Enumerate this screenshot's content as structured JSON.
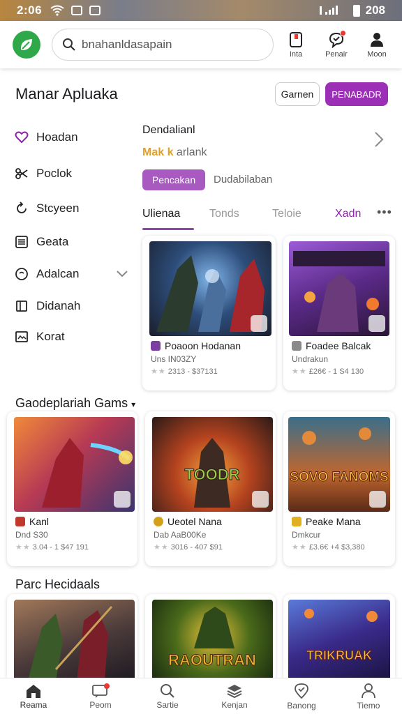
{
  "status_bar": {
    "time": "2:06",
    "right_text": "208"
  },
  "search": {
    "value": "bnahanl",
    "placeholder": "dasapain"
  },
  "top_actions": [
    {
      "label": "Inta"
    },
    {
      "label": "Penair"
    },
    {
      "label": "Moon"
    }
  ],
  "page": {
    "title": "Manar Apluaka",
    "outline_button": "Garnen",
    "primary_button": "PENABADR"
  },
  "sidebar": {
    "items": [
      {
        "label": "Hoadan"
      },
      {
        "label": "Poclok"
      },
      {
        "label": "Stcyeen"
      },
      {
        "label": "Geata"
      },
      {
        "label": "Adalcan"
      },
      {
        "label": "Didanah"
      },
      {
        "label": "Korat"
      }
    ]
  },
  "detail": {
    "title": "Dendalianl",
    "highlight": "Mak k",
    "subtitle_rest": " arlank",
    "chip_active": "Pencakan",
    "chip_plain": "Dudabilaban"
  },
  "tabs": [
    {
      "label": "Ulienaa"
    },
    {
      "label": "Tonds"
    },
    {
      "label": "Teloie"
    },
    {
      "label": "Xadn"
    }
  ],
  "tab_more": "•••",
  "featured_cards": [
    {
      "name": "Poaoon Hodanan",
      "dev": "Uns IN03ZY",
      "rating": "2313 - $37131"
    },
    {
      "name": "Foadee Balcak",
      "dev": "Undrakun",
      "rating": "£26€ - 1 S4 130"
    }
  ],
  "section_recommended": {
    "title": "Gaodeplariah Gams"
  },
  "recommended_cards": [
    {
      "name": "Kanl",
      "dev": "Dnd S30",
      "rating": "3.04 - 1 $47 191",
      "art_text": ""
    },
    {
      "name": "Ueotel Nana",
      "dev": "Dab AaB00Ke",
      "rating": "3016 - 407 $91",
      "art_text": "TOODR"
    },
    {
      "name": "Peake Mana",
      "dev": "Dmkcur",
      "rating": "£3.6€ +4 $3,380",
      "art_text": "SOVO FANOMS"
    }
  ],
  "section_more": {
    "title": "Parc Hecidaals"
  },
  "more_cards": [
    {
      "art_text": ""
    },
    {
      "art_text": "RAOUTRAN"
    },
    {
      "art_text": "TRIKRUAK"
    }
  ],
  "bottom_nav": [
    {
      "label": "Reama"
    },
    {
      "label": "Peom"
    },
    {
      "label": "Sartie"
    },
    {
      "label": "Kenjan"
    },
    {
      "label": "Banong"
    },
    {
      "label": "Tiemo"
    }
  ],
  "colors": {
    "accent": "#9b2fb5",
    "logo": "#2fa84a",
    "highlight": "#e0a02c"
  },
  "icons": [
    "search-icon",
    "notification-icon",
    "chat-icon",
    "profile-icon",
    "home-icon",
    "message-icon",
    "layers-icon",
    "location-icon",
    "chevron-right-icon",
    "chevron-down-icon"
  ]
}
